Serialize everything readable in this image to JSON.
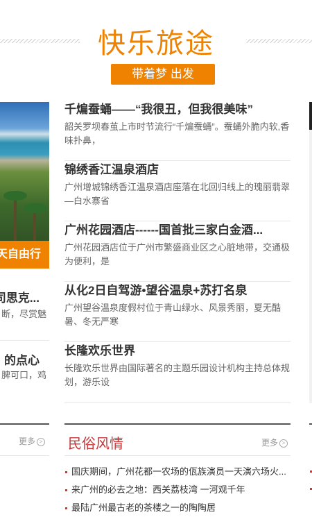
{
  "header": {
    "title": "快乐旅途",
    "slogan": "带着梦 出发"
  },
  "left_column": {
    "banner_text": "天自由行",
    "items": [
      {
        "title": "司思克...",
        "desc": "断，尽赏魅"
      },
      {
        "title": "的点心",
        "desc": "脾可口，鸡"
      }
    ],
    "more_label": "更多"
  },
  "articles": [
    {
      "title": "千煸蚕蛹——“我很丑，但我很美味”",
      "desc": "韶关罗坝春茧上市时节流行“千煸蚕蛹”。蚕蛹外脆内软,香味扑鼻，"
    },
    {
      "title": "锦绣香江温泉酒店",
      "desc": "广州增城锦绣香江温泉酒店座落在北回归线上的瑰丽翡翠—白水寨省"
    },
    {
      "title": "广州花园酒店------国首批三家白金酒...",
      "desc": "广州花园酒店位于广州市繁盛商业区之心脏地带，交通极为便利，是"
    },
    {
      "title": "从化2日自驾游•望谷温泉+苏打名泉",
      "desc": "广州望谷温泉度假村位于青山绿水、风景秀丽，夏无酷暑、冬无严寒"
    },
    {
      "title": "长隆欢乐世界",
      "desc": "长隆欢乐世界由国际著名的主题乐园设计机构主持总体规划，游乐设"
    }
  ],
  "folk_section": {
    "title": "民俗风情",
    "more_label": "更多",
    "items": [
      "国庆期间，广州花都一农场的佤族演员一天演六场火...",
      "来广州的必去之地：西关荔枝湾 一河观千年",
      "最陆广州最古老的茶楼之一的陶陶居"
    ]
  },
  "colors": {
    "accent": "#ef8200",
    "section_red": "#c8383a"
  }
}
